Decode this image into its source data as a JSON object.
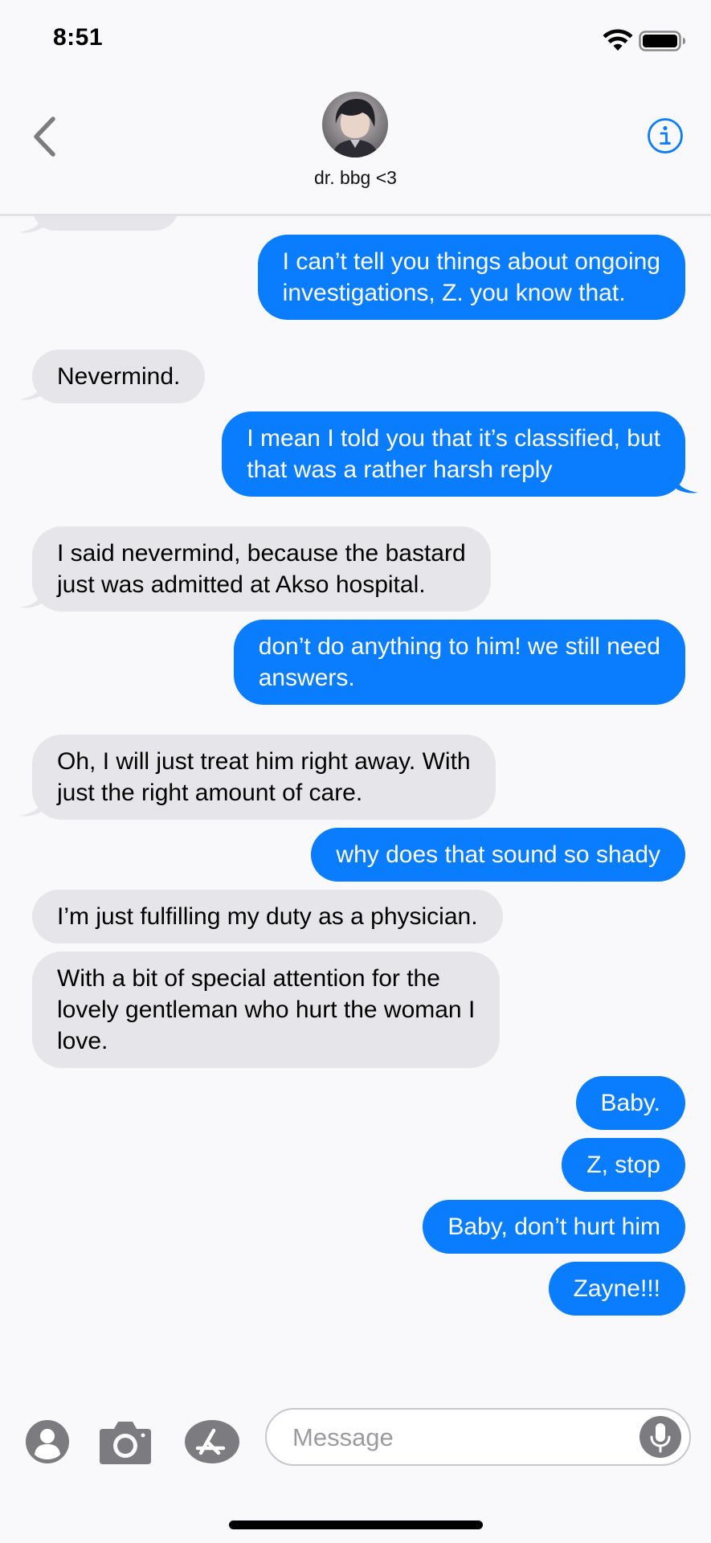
{
  "status_bar": {
    "time": "8:51"
  },
  "header": {
    "contact_name": "dr. bbg <3",
    "back_icon": "chevron-left-icon",
    "info_icon": "info-circle-icon"
  },
  "messages": [
    {
      "direction": "in",
      "text": "",
      "partial": true
    },
    {
      "direction": "out",
      "text": "I can’t tell you things about ongoing\ninvestigations, Z. you know that."
    },
    {
      "direction": "in",
      "text": "Nevermind."
    },
    {
      "direction": "out",
      "text": "I mean I told you that it’s classified, but\nthat was a rather harsh reply"
    },
    {
      "direction": "in",
      "text": "I said nevermind, because the bastard\njust was admitted at Akso hospital."
    },
    {
      "direction": "out",
      "text": "don’t do anything to him! we still need\nanswers."
    },
    {
      "direction": "in",
      "text": "Oh, I will just treat him right away. With\njust the right amount of care."
    },
    {
      "direction": "out",
      "text": "why does that sound so shady"
    },
    {
      "direction": "in",
      "text": "I’m just fulfilling my duty as a physician."
    },
    {
      "direction": "in",
      "text": "With a bit of special attention for the\nlovely gentleman who hurt the woman I\nlove."
    },
    {
      "direction": "out",
      "text": "Baby."
    },
    {
      "direction": "out",
      "text": "Z, stop"
    },
    {
      "direction": "out",
      "text": "Baby, don’t hurt him"
    },
    {
      "direction": "out",
      "text": "Zayne!!!"
    }
  ],
  "input_bar": {
    "placeholder": "Message",
    "value": "",
    "icons": [
      "contacts-icon",
      "camera-icon",
      "app-store-icon",
      "microphone-icon"
    ]
  },
  "colors": {
    "outgoing_bubble": "#0a7cfe",
    "incoming_bubble": "#e6e5ea",
    "accent": "#0a7cfe",
    "background": "#f9f9fb"
  }
}
